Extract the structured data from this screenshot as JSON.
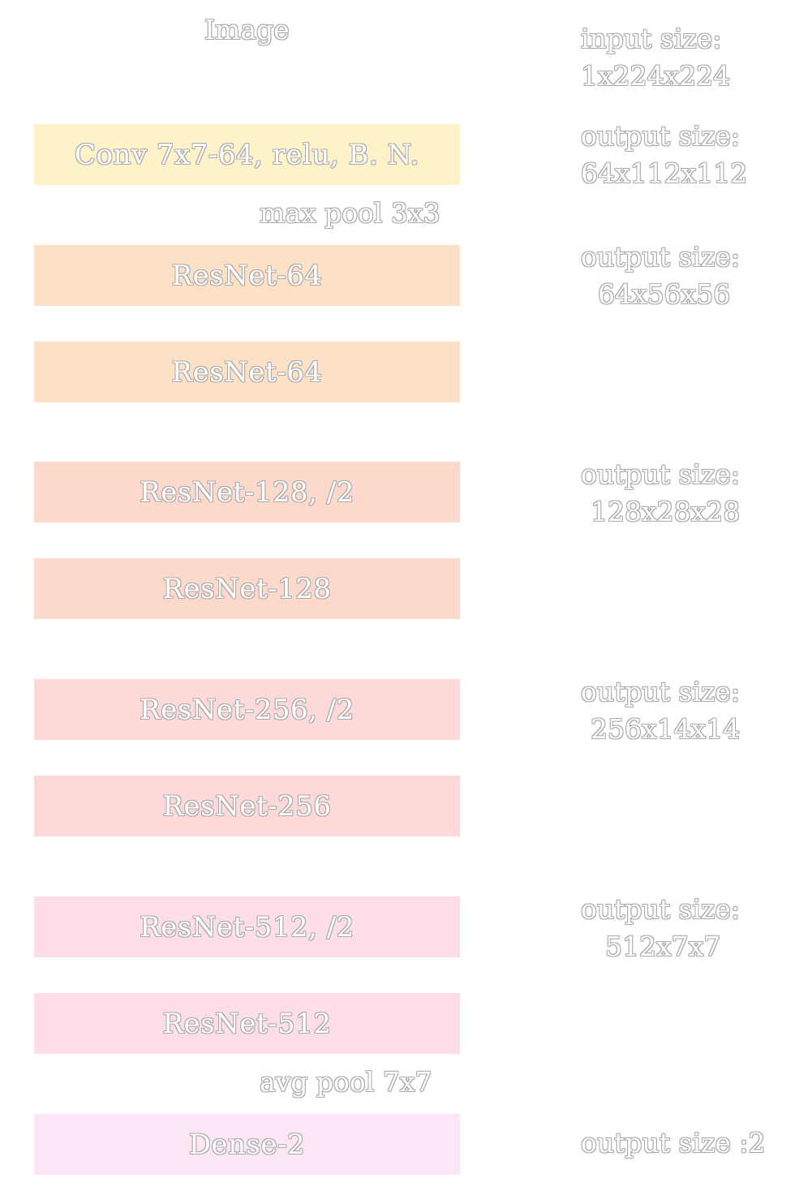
{
  "input": {
    "title": "Image",
    "size_label": "input size:",
    "size_value": "1x224x224"
  },
  "blocks": [
    {
      "label": "Conv 7x7-64, relu, B. N.",
      "color": "#fff2c8"
    },
    {
      "label": "ResNet-64",
      "color": "#fde1c6"
    },
    {
      "label": "ResNet-64",
      "color": "#fde1c6"
    },
    {
      "label": "ResNet-128, /2",
      "color": "#fdd9cb"
    },
    {
      "label": "ResNet-128",
      "color": "#fdd9cb"
    },
    {
      "label": "ResNet-256, /2",
      "color": "#fdd9d9"
    },
    {
      "label": "ResNet-256",
      "color": "#fdd9d9"
    },
    {
      "label": "ResNet-512, /2",
      "color": "#fcdde8"
    },
    {
      "label": "ResNet-512",
      "color": "#fcdde8"
    },
    {
      "label": "Dense-2",
      "color": "#fce6f6"
    }
  ],
  "pool_labels": {
    "max_pool": "max pool 3x3",
    "avg_pool": "avg pool 7x7"
  },
  "outputs": [
    {
      "label": "output size:",
      "value": "64x112x112"
    },
    {
      "label": "output size:",
      "value": "64x56x56"
    },
    {
      "label": "output size:",
      "value": "128x28x28"
    },
    {
      "label": "output size:",
      "value": "256x14x14"
    },
    {
      "label": "output size:",
      "value": "512x7x7"
    }
  ],
  "final_output": "output size :2"
}
